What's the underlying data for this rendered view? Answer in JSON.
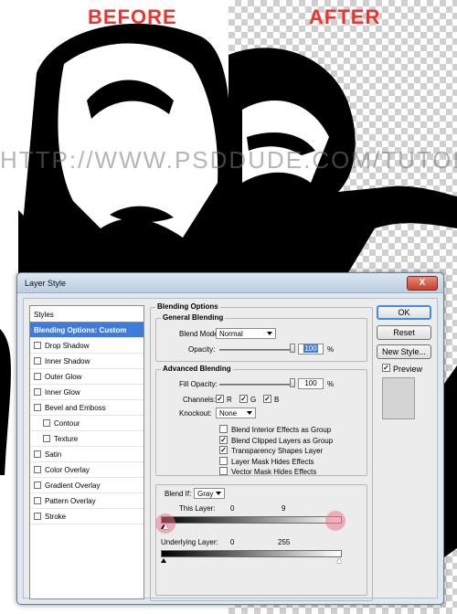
{
  "art": {
    "before_label": "BEFORE",
    "after_label": "AFTER",
    "watermark": "HTTP://WWW.PSDDUDE.COM/TUTORIALS/"
  },
  "dialog": {
    "title": "Layer Style",
    "close": "X",
    "styles_header": "Styles",
    "styles": [
      {
        "label": "Blending Options: Custom",
        "selected": true,
        "checkbox": false,
        "indent": false
      },
      {
        "label": "Drop Shadow",
        "selected": false,
        "checkbox": true,
        "indent": false
      },
      {
        "label": "Inner Shadow",
        "selected": false,
        "checkbox": true,
        "indent": false
      },
      {
        "label": "Outer Glow",
        "selected": false,
        "checkbox": true,
        "indent": false
      },
      {
        "label": "Inner Glow",
        "selected": false,
        "checkbox": true,
        "indent": false
      },
      {
        "label": "Bevel and Emboss",
        "selected": false,
        "checkbox": true,
        "indent": false
      },
      {
        "label": "Contour",
        "selected": false,
        "checkbox": true,
        "indent": true
      },
      {
        "label": "Texture",
        "selected": false,
        "checkbox": true,
        "indent": true
      },
      {
        "label": "Satin",
        "selected": false,
        "checkbox": true,
        "indent": false
      },
      {
        "label": "Color Overlay",
        "selected": false,
        "checkbox": true,
        "indent": false
      },
      {
        "label": "Gradient Overlay",
        "selected": false,
        "checkbox": true,
        "indent": false
      },
      {
        "label": "Pattern Overlay",
        "selected": false,
        "checkbox": true,
        "indent": false
      },
      {
        "label": "Stroke",
        "selected": false,
        "checkbox": true,
        "indent": false
      }
    ],
    "blending": {
      "section_title": "Blending Options",
      "general_title": "General Blending",
      "blend_mode_label": "Blend Mode:",
      "blend_mode_value": "Normal",
      "opacity_label": "Opacity:",
      "opacity_value": "100",
      "percent": "%",
      "advanced_title": "Advanced Blending",
      "fill_opacity_label": "Fill Opacity:",
      "fill_opacity_value": "100",
      "channels_label": "Channels:",
      "channel_r": "R",
      "channel_g": "G",
      "channel_b": "B",
      "knockout_label": "Knockout:",
      "knockout_value": "None",
      "options": [
        {
          "label": "Blend Interior Effects as Group",
          "checked": false
        },
        {
          "label": "Blend Clipped Layers as Group",
          "checked": true
        },
        {
          "label": "Transparency Shapes Layer",
          "checked": true
        },
        {
          "label": "Layer Mask Hides Effects",
          "checked": false
        },
        {
          "label": "Vector Mask Hides Effects",
          "checked": false
        }
      ],
      "blend_if_label": "Blend If:",
      "blend_if_value": "Gray",
      "this_layer_label": "This Layer:",
      "this_layer_low": "0",
      "this_layer_high": "9",
      "underlying_label": "Underlying Layer:",
      "underlying_low": "0",
      "underlying_high": "255"
    },
    "buttons": {
      "ok": "OK",
      "reset": "Reset",
      "new_style": "New Style...",
      "preview": "Preview"
    }
  }
}
